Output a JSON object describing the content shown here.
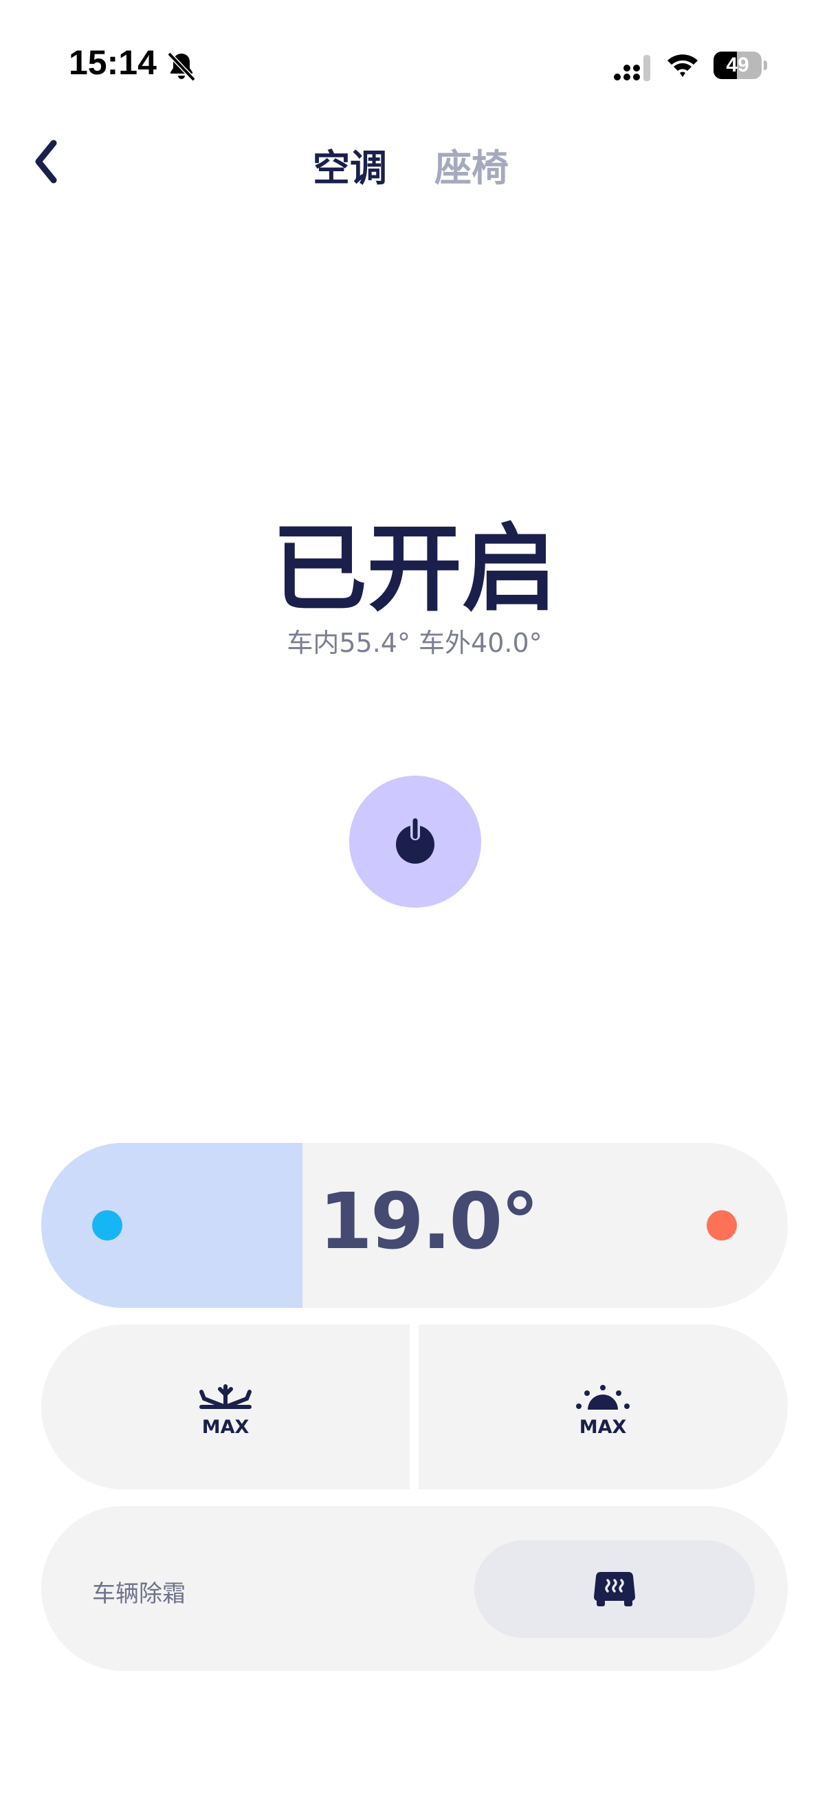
{
  "status_bar": {
    "time": "15:14",
    "battery": "49",
    "battery_level": 0.49,
    "icons": [
      "bell-slash-icon",
      "cellular-signal-icon",
      "wifi-icon",
      "battery-icon"
    ]
  },
  "header": {
    "back_icon": "chevron-left-icon",
    "tabs": [
      {
        "label": "空调",
        "active": true
      },
      {
        "label": "座椅",
        "active": false
      }
    ]
  },
  "climate": {
    "status": "已开启",
    "temps": "车内55.4° 车外40.0°",
    "power_icon": "power-icon",
    "set_temperature": "19.0°",
    "slider_fraction": 0.35,
    "cold_color": "#15b6f3",
    "hot_color": "#fd7158"
  },
  "max_buttons": {
    "cool": {
      "icon": "max-cool-snowflake-icon",
      "label": "MAX"
    },
    "heat": {
      "icon": "max-heat-sun-icon",
      "label": "MAX"
    }
  },
  "defrost": {
    "label": "车辆除霜",
    "icon": "car-defrost-icon"
  },
  "colors": {
    "accent": "#cdc8ff",
    "text_primary": "#1a1f4b",
    "text_muted": "#a6a9be",
    "panel_bg": "#f3f3f4"
  }
}
